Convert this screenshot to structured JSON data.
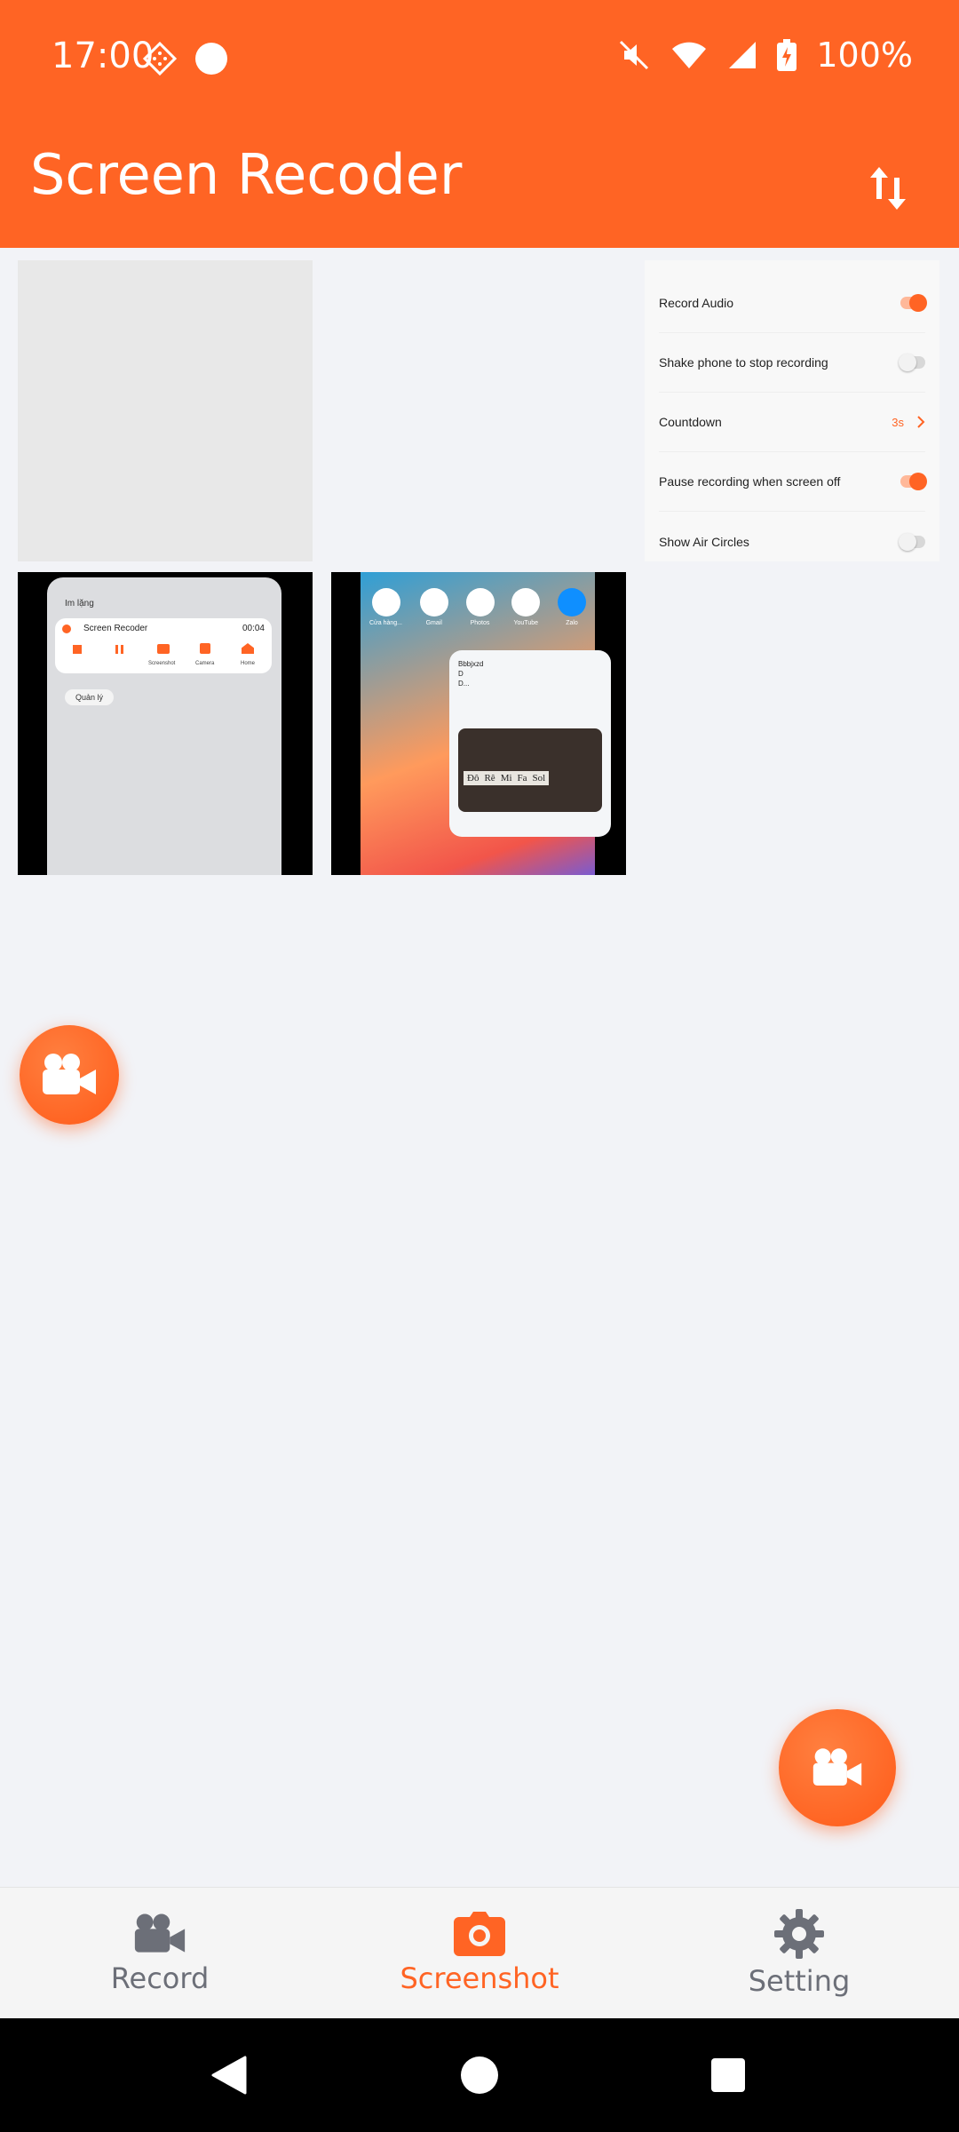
{
  "status_bar": {
    "time": "17:00",
    "battery": "100%"
  },
  "header": {
    "title": "Screen Recoder"
  },
  "settings_preview": {
    "rows": [
      {
        "label": "Record Audio",
        "toggle": "on"
      },
      {
        "label": "Shake phone to stop recording",
        "toggle": "off"
      },
      {
        "label": "Countdown",
        "value": "3s"
      },
      {
        "label": "Pause recording when screen off",
        "toggle": "on"
      },
      {
        "label": "Show Air Circles",
        "toggle": "off"
      }
    ]
  },
  "recorder_preview": {
    "silent_label": "Im lặng",
    "app_name": "Screen Recoder",
    "timer": "00:04",
    "actions": [
      "Screenshot",
      "Camera",
      "Home"
    ],
    "manage_label": "Quản lý"
  },
  "home_preview": {
    "apps": [
      "Cửa hàng...",
      "Gmail",
      "Photos",
      "YouTube",
      "Zalo"
    ],
    "note_lines": [
      "Bbbjxzd",
      "D",
      "D..."
    ],
    "solfege": [
      "Đô",
      "Rê",
      "Mi",
      "Fa",
      "Sol"
    ]
  },
  "bottom_nav": {
    "items": [
      {
        "label": "Record",
        "icon": "video-camera-icon",
        "active": false
      },
      {
        "label": "Screenshot",
        "icon": "camera-icon",
        "active": true
      },
      {
        "label": "Setting",
        "icon": "gear-icon",
        "active": false
      }
    ]
  },
  "colors": {
    "accent": "#ff6424",
    "inactive": "#6c6f78",
    "background": "#f2f3f7"
  }
}
